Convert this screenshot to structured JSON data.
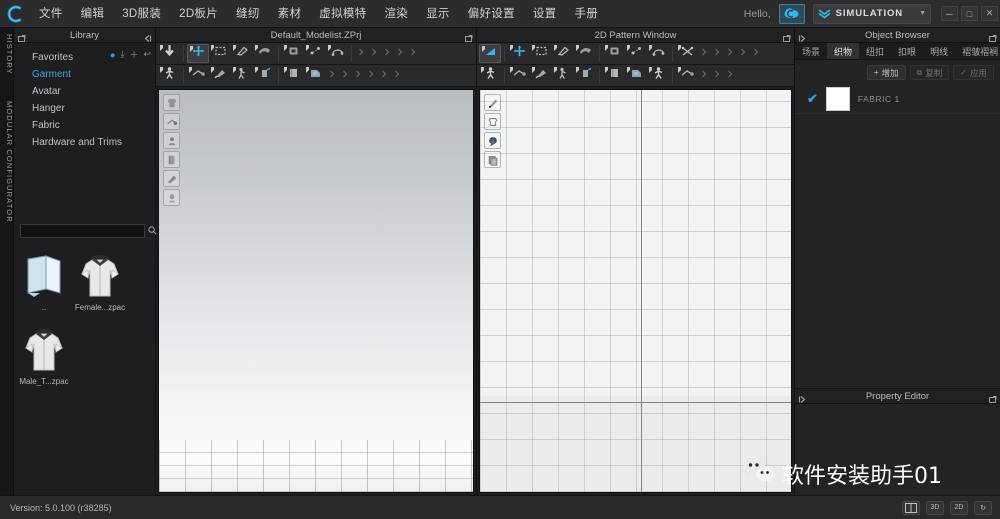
{
  "app": {
    "logo_icon": "clo-c-logo-icon",
    "version_text": "Version: 5.0.100 (r38285)"
  },
  "menubar": {
    "items": [
      {
        "label": "文件"
      },
      {
        "label": "编辑"
      },
      {
        "label": "3D服装"
      },
      {
        "label": "2D板片"
      },
      {
        "label": "缝纫"
      },
      {
        "label": "素材"
      },
      {
        "label": "虚拟模特"
      },
      {
        "label": "渲染"
      },
      {
        "label": "显示"
      },
      {
        "label": "偏好设置"
      },
      {
        "label": "设置"
      },
      {
        "label": "手册"
      }
    ],
    "hello_label": "Hello,",
    "cloud_icon": "cloud-icon",
    "mode": {
      "icon": "simulation-chevrons-icon",
      "label": "SIMULATION",
      "caret": "▼"
    },
    "window_buttons": [
      {
        "icon": "minimize-icon",
        "glyph": "─"
      },
      {
        "icon": "maximize-icon",
        "glyph": "□"
      },
      {
        "icon": "close-icon",
        "glyph": "✕"
      }
    ]
  },
  "left_vertical_tabs": [
    {
      "label": "HISTORY"
    },
    {
      "label": "MODULAR CONFIGURATOR"
    }
  ],
  "library": {
    "header": {
      "title": "Library",
      "undock_icon": "undock-icon",
      "collapse_icon": "collapse-left-icon"
    },
    "tree": [
      {
        "label": "Favorites",
        "active": false
      },
      {
        "label": "Garment",
        "active": true
      },
      {
        "label": "Avatar",
        "active": false
      },
      {
        "label": "Hanger",
        "active": false
      },
      {
        "label": "Fabric",
        "active": false
      },
      {
        "label": "Hardware and Trims",
        "active": false
      }
    ],
    "tree_tools": [
      {
        "icon": "sync-badge-icon",
        "glyph": "●"
      },
      {
        "icon": "download-icon",
        "glyph": "⤓"
      },
      {
        "icon": "add-icon",
        "glyph": "＋"
      },
      {
        "icon": "back-icon",
        "glyph": "↩"
      }
    ],
    "search": {
      "value": "",
      "placeholder": "",
      "search_icon": "search-icon",
      "caret_icon": "chevron-down-icon",
      "refresh_icon": "refresh-icon",
      "list_view_icon": "list-view-icon"
    },
    "items": [
      {
        "caption": "..",
        "thumb": "folder-up-icon"
      },
      {
        "caption": "Female...zpac",
        "thumb": "female-shirt-thumb"
      },
      {
        "caption": "Male_T...zpac",
        "thumb": "male-shirt-thumb"
      }
    ]
  },
  "view3d": {
    "header": {
      "title": "Default_Modelist.ZPrj",
      "undock_icon": "undock-icon"
    },
    "toolbar_row1": [
      {
        "icon": "simulate-icon",
        "selected": false
      },
      {
        "icon": "transform-move-icon",
        "selected": true
      },
      {
        "icon": "select-mesh-box-icon",
        "selected": false
      },
      {
        "icon": "select-mesh-icon",
        "selected": false
      },
      {
        "icon": "pin-icon",
        "selected": false
      },
      {
        "icon": "fold-arrange-icon",
        "selected": false
      },
      {
        "icon": "sewing-3d-icon",
        "selected": false
      },
      {
        "icon": "sewing-free-icon",
        "selected": false
      },
      {
        "icon": "more-1-icon",
        "selected": false
      },
      {
        "icon": "more-2-icon",
        "selected": false
      },
      {
        "icon": "more-3-icon",
        "selected": false
      },
      {
        "icon": "more-4-icon",
        "selected": false
      },
      {
        "icon": "more-5-icon",
        "selected": false
      }
    ],
    "toolbar_row2": [
      {
        "icon": "avatar-pose-icon",
        "selected": false
      },
      {
        "icon": "avatar-xray-icon",
        "selected": false
      },
      {
        "icon": "avatar-gizmo-icon",
        "selected": false
      },
      {
        "icon": "avatar-measure-icon",
        "selected": false
      },
      {
        "icon": "avatar-skin-icon",
        "selected": false
      },
      {
        "icon": "fabric-book-icon",
        "selected": false
      },
      {
        "icon": "texture-edit-icon",
        "selected": false
      },
      {
        "icon": "more-6-icon",
        "selected": false
      },
      {
        "icon": "more-7-icon",
        "selected": false
      },
      {
        "icon": "more-8-icon",
        "selected": false
      },
      {
        "icon": "more-9-icon",
        "selected": false
      },
      {
        "icon": "more-10-icon",
        "selected": false
      },
      {
        "icon": "more-11-icon",
        "selected": false
      }
    ],
    "viewport_tools": [
      {
        "icon": "garment-icon"
      },
      {
        "icon": "light-icon"
      },
      {
        "icon": "avatar-icon"
      },
      {
        "icon": "fabric-icon"
      },
      {
        "icon": "render-icon"
      },
      {
        "icon": "head-icon"
      }
    ]
  },
  "view2d": {
    "header": {
      "title": "2D Pattern Window",
      "undock_icon": "undock-icon"
    },
    "toolbar_row1": [
      {
        "icon": "edit-pattern-icon",
        "selected": true
      },
      {
        "icon": "edit-point-icon",
        "selected": false
      },
      {
        "icon": "edit-curve-icon",
        "selected": false
      },
      {
        "icon": "edit-curve-point-icon",
        "selected": false
      },
      {
        "icon": "add-point-icon",
        "selected": false
      },
      {
        "icon": "slash-line-icon",
        "selected": false
      },
      {
        "icon": "polygon-icon",
        "selected": false
      },
      {
        "icon": "rect-pattern-icon",
        "selected": false
      },
      {
        "icon": "internal-polygon-icon",
        "selected": false
      },
      {
        "icon": "more-a-icon",
        "selected": false
      },
      {
        "icon": "more-b-icon",
        "selected": false
      },
      {
        "icon": "more-c-icon",
        "selected": false
      },
      {
        "icon": "more-d-icon",
        "selected": false
      },
      {
        "icon": "more-e-icon",
        "selected": false
      }
    ],
    "toolbar_row2": [
      {
        "icon": "pleat-icon",
        "selected": false
      },
      {
        "icon": "sewing-segment-icon",
        "selected": false
      },
      {
        "icon": "sewing-free-2d-icon",
        "selected": false
      },
      {
        "icon": "check-sewing-icon",
        "selected": false
      },
      {
        "icon": "fold-arrange-2d-icon",
        "selected": false
      },
      {
        "icon": "trim-icon",
        "selected": false
      },
      {
        "icon": "texture-2d-icon",
        "selected": false
      },
      {
        "icon": "button-icon",
        "selected": false
      },
      {
        "icon": "buttonhole-icon",
        "selected": false
      },
      {
        "icon": "more-f-icon",
        "selected": false
      },
      {
        "icon": "more-g-icon",
        "selected": false
      },
      {
        "icon": "more-h-icon",
        "selected": false
      }
    ],
    "viewport_tools": [
      {
        "icon": "pencil-icon"
      },
      {
        "icon": "shirt-outline-icon"
      },
      {
        "icon": "info-bubble-icon"
      },
      {
        "icon": "layers-icon"
      }
    ]
  },
  "object_browser": {
    "header": {
      "title": "Object Browser",
      "pin_icon": "pin-left-icon",
      "undock_icon": "undock-icon"
    },
    "tabs": [
      {
        "label": "场景",
        "active": false
      },
      {
        "label": "织物",
        "active": true
      },
      {
        "label": "纽扣",
        "active": false
      },
      {
        "label": "扣眼",
        "active": false
      },
      {
        "label": "明线",
        "active": false
      },
      {
        "label": "褶皱褶裥",
        "active": false
      }
    ],
    "tab_arrows": [
      {
        "icon": "chevron-left-icon",
        "glyph": "◀"
      },
      {
        "icon": "chevron-right-icon",
        "glyph": "▶"
      }
    ],
    "actions": [
      {
        "label": "增加",
        "icon": "plus-icon",
        "enabled": true
      },
      {
        "label": "复制",
        "icon": "copy-icon",
        "enabled": false
      },
      {
        "label": "应用",
        "icon": "apply-icon",
        "enabled": false
      }
    ],
    "rows": [
      {
        "checked": true,
        "check_icon": "check-icon",
        "swatch_color": "#ffffff",
        "name": "FABRIC 1"
      }
    ]
  },
  "property_editor": {
    "header": {
      "title": "Property Editor",
      "pin_icon": "pin-left-icon",
      "undock_icon": "undock-icon"
    }
  },
  "statusbar": {
    "version": "Version: 5.0.100 (r38285)",
    "buttons": [
      {
        "icon": "split-view-icon",
        "label": ""
      },
      {
        "icon": "view-3d-icon",
        "label": "3D"
      },
      {
        "icon": "view-2d-icon",
        "label": "2D"
      },
      {
        "icon": "reset-view-icon",
        "label": "↻"
      }
    ]
  },
  "watermark": {
    "icon": "wechat-icon",
    "text": "软件安装助手01"
  },
  "colors": {
    "accent_blue": "#45a8e0",
    "check_blue": "#2f9fe0",
    "panel_bg": "#232326",
    "menubar_bg": "#2c2c2e",
    "toolbar_bg": "#2a2a2d"
  }
}
